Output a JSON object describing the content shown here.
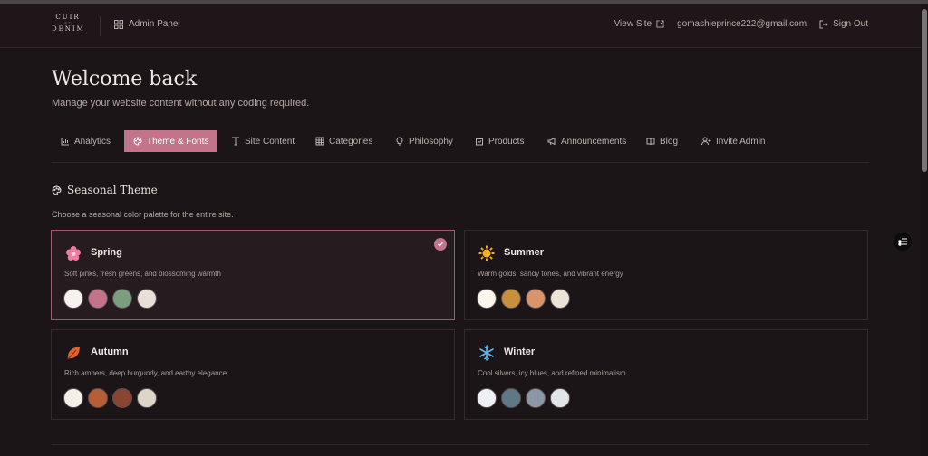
{
  "logo": {
    "line1": "CUIR",
    "line2": "ET",
    "line3": "DENIM"
  },
  "header": {
    "admin_label": "Admin Panel",
    "view_site": "View Site",
    "email": "gomashieprince222@gmail.com",
    "sign_out": "Sign Out"
  },
  "hero": {
    "title": "Welcome back",
    "subtitle": "Manage your website content without any coding required."
  },
  "tabs": [
    {
      "label": "Analytics",
      "icon": "bar-chart-icon",
      "active": false
    },
    {
      "label": "Theme & Fonts",
      "icon": "palette-icon",
      "active": true
    },
    {
      "label": "Site Content",
      "icon": "text-icon",
      "active": false
    },
    {
      "label": "Categories",
      "icon": "grid-icon",
      "active": false
    },
    {
      "label": "Philosophy",
      "icon": "lightbulb-icon",
      "active": false
    },
    {
      "label": "Products",
      "icon": "shopping-bag-icon",
      "active": false
    },
    {
      "label": "Announcements",
      "icon": "megaphone-icon",
      "active": false
    },
    {
      "label": "Blog",
      "icon": "book-icon",
      "active": false
    },
    {
      "label": "Invite Admin",
      "icon": "user-plus-icon",
      "active": false
    }
  ],
  "section": {
    "title": "Seasonal Theme",
    "description": "Choose a seasonal color palette for the entire site."
  },
  "themes": [
    {
      "name": "Spring",
      "description": "Soft pinks, fresh greens, and blossoming warmth",
      "icon": "flower-icon",
      "selected": true,
      "colors": [
        "#f7f2ec",
        "#c4748a",
        "#7a9e7e",
        "#e8e0d8"
      ]
    },
    {
      "name": "Summer",
      "description": "Warm golds, sandy tones, and vibrant energy",
      "icon": "sun-icon",
      "selected": false,
      "colors": [
        "#faf6ee",
        "#c8903c",
        "#d9946c",
        "#ebe3d6"
      ]
    },
    {
      "name": "Autumn",
      "description": "Rich ambers, deep burgundy, and earthy elegance",
      "icon": "leaf-icon",
      "selected": false,
      "colors": [
        "#f4f0e6",
        "#b85e36",
        "#8a4432",
        "#dcd6c8"
      ]
    },
    {
      "name": "Winter",
      "description": "Cool silvers, icy blues, and refined minimalism",
      "icon": "snowflake-icon",
      "selected": false,
      "colors": [
        "#eef0f4",
        "#5e7888",
        "#8a97a6",
        "#e2e4e8"
      ]
    }
  ],
  "colors": {
    "accent": "#c4748a",
    "background": "#1c1518"
  }
}
